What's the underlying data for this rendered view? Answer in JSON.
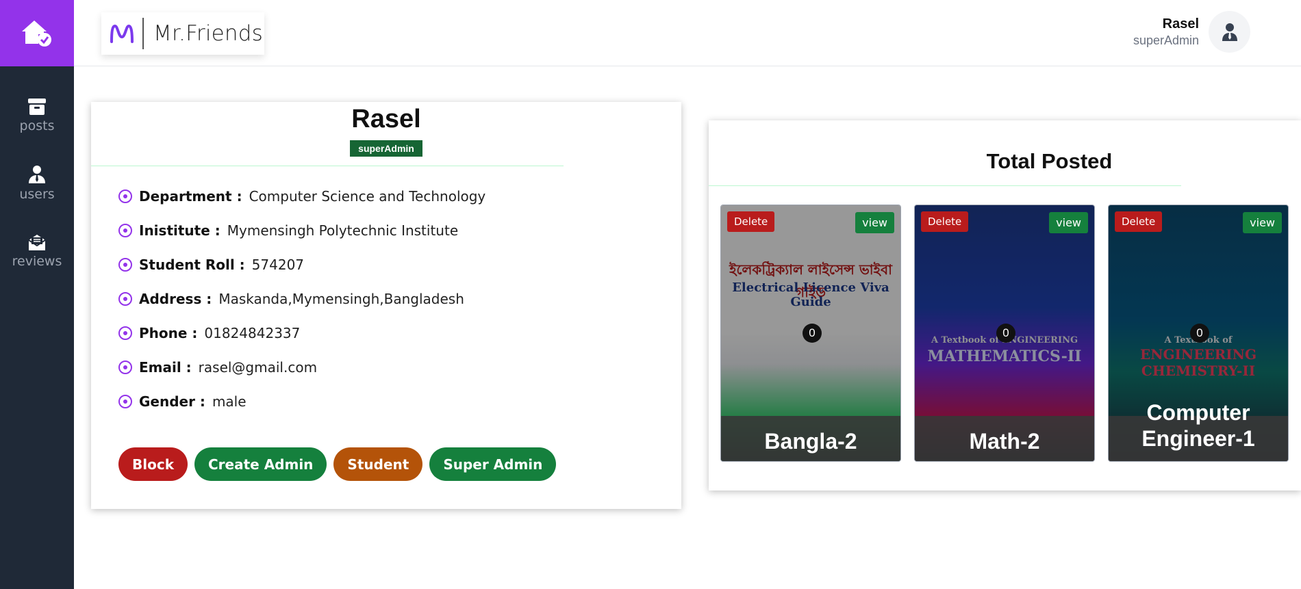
{
  "sidebar": {
    "logo_icon": "home-check-icon",
    "items": [
      {
        "label": "posts",
        "icon": "archive-box-icon"
      },
      {
        "label": "users",
        "icon": "user-tie-icon"
      },
      {
        "label": "reviews",
        "icon": "envelope-open-icon"
      }
    ]
  },
  "header": {
    "brand_mark": "M",
    "brand_name": "Mr.Friends",
    "user_name": "Rasel",
    "user_role": "superAdmin"
  },
  "profile": {
    "name": "Rasel",
    "role": "superAdmin",
    "fields": [
      {
        "label": "Department :",
        "value": "Computer Science and Technology"
      },
      {
        "label": "Inistitute :",
        "value": "Mymensingh Polytechnic Institute"
      },
      {
        "label": "Student Roll :",
        "value": "574207"
      },
      {
        "label": "Address :",
        "value": "Maskanda,Mymensingh,Bangladesh"
      },
      {
        "label": "Phone :",
        "value": "01824842337"
      },
      {
        "label": "Email :",
        "value": "rasel@gmail.com"
      },
      {
        "label": "Gender :",
        "value": "male"
      }
    ],
    "actions": [
      {
        "label": "Block",
        "color": "#b91c1c"
      },
      {
        "label": "Create Admin",
        "color": "#15803d"
      },
      {
        "label": "Student",
        "color": "#b45309"
      },
      {
        "label": "Super Admin",
        "color": "#15803d"
      }
    ]
  },
  "posted": {
    "title": "Total Posted",
    "books": [
      {
        "title": "Bangla-2",
        "count": "0",
        "delete_label": "Delete",
        "view_label": "view",
        "cover_lines": [
          "ইলেকট্রিক্যাল লাইসেন্স ভাইবা গাইড",
          "Electrical Licence Viva Guide"
        ]
      },
      {
        "title": "Math-2",
        "count": "0",
        "delete_label": "Delete",
        "view_label": "view",
        "cover_lines": [
          "A Textbook of ENGINEERING",
          "MATHEMATICS-II"
        ]
      },
      {
        "title": "Computer Engineer-1",
        "count": "0",
        "delete_label": "Delete",
        "view_label": "view",
        "cover_lines": [
          "A Textbook of",
          "ENGINEERING CHEMISTRY-II"
        ]
      }
    ]
  },
  "colors": {
    "accent": "#9333ea",
    "sidebar_bg": "#1f2937",
    "badge_green": "#166534"
  }
}
